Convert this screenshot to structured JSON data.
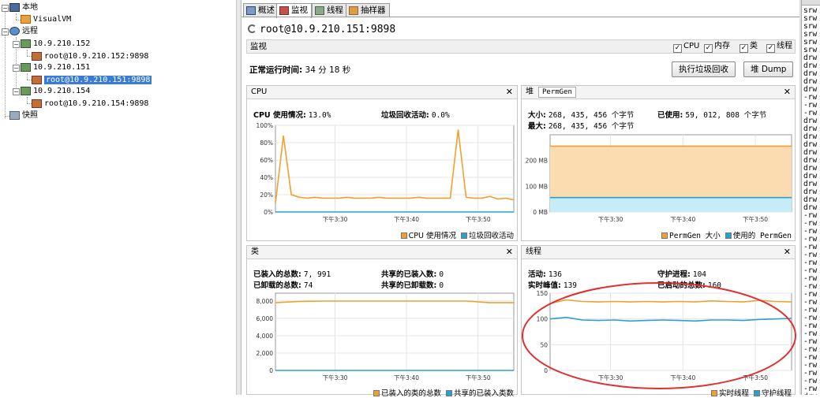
{
  "tree": {
    "local": "本地",
    "visualvm": "VisualVM",
    "remote": "远程",
    "hosts": [
      {
        "name": "10.9.210.152",
        "app": "root@10.9.210.152:9898"
      },
      {
        "name": "10.9.210.151",
        "app": "root@10.9.210.151:9898"
      },
      {
        "name": "10.9.210.154",
        "app": "root@10.9.210.154:9898"
      }
    ],
    "snapshots": "快照"
  },
  "tabs": [
    "概述",
    "监视",
    "线程",
    "抽样器"
  ],
  "active_tab": "监视",
  "title": "root@10.9.210.151:9898",
  "monitor": {
    "label": "监视",
    "checkboxes": [
      "CPU",
      "内存",
      "类",
      "线程"
    ],
    "uptime_label": "正常运行时间:",
    "uptime_value": "34 分 18 秒",
    "gc_button": "执行垃圾回收",
    "heapdump_button": "堆 Dump"
  },
  "cpu_panel": {
    "title": "CPU",
    "usage_label": "CPU 使用情况:",
    "usage_value": "13.0%",
    "gc_label": "垃圾回收活动:",
    "gc_value": "0.0%",
    "legend": [
      "CPU 使用情况",
      "垃圾回收活动"
    ]
  },
  "heap_panel": {
    "tab1": "堆",
    "tab2": "PermGen",
    "size_label": "大小:",
    "size_value": "268, 435, 456 个字节",
    "used_label": "已使用:",
    "used_value": "59, 012, 808 个字节",
    "max_label": "最大:",
    "max_value": "268, 435, 456 个字节",
    "legend": [
      "PermGen 大小",
      "使用的 PermGen"
    ]
  },
  "class_panel": {
    "title": "类",
    "loaded_label": "已装入的总数:",
    "loaded_value": "7, 991",
    "unloaded_label": "已卸载的总数:",
    "unloaded_value": "74",
    "shared_loaded_label": "共享的已装入数:",
    "shared_loaded_value": "0",
    "shared_unloaded_label": "共享的已卸载数:",
    "shared_unloaded_value": "0",
    "legend": [
      "已装入的类的总数",
      "共享的已装入类数"
    ]
  },
  "thread_panel": {
    "title": "线程",
    "live_label": "活动:",
    "live_value": "136",
    "daemon_label": "守护进程:",
    "daemon_value": "104",
    "peak_label": "实时峰值:",
    "peak_value": "139",
    "started_label": "已启动的总数:",
    "started_value": "160",
    "legend": [
      "实时线程",
      "守护线程"
    ]
  },
  "time_ticks": [
    "下午3:30",
    "下午3:40",
    "下午3:50"
  ],
  "colors": {
    "orange": "#f0a030",
    "blue": "#2aa0d0",
    "annotation": "#e03030"
  },
  "chart_data": [
    {
      "type": "line",
      "name": "CPU",
      "ylim": [
        0,
        100
      ],
      "yticks": [
        "0%",
        "20%",
        "40%",
        "60%",
        "80%",
        "100%"
      ],
      "series": [
        {
          "name": "CPU 使用情况",
          "values": [
            10,
            88,
            20,
            17,
            16,
            17,
            16,
            16,
            16,
            17,
            16,
            16,
            16,
            17,
            16,
            16,
            16,
            16,
            17,
            16,
            16,
            16,
            16,
            95,
            17,
            16,
            16,
            18,
            15,
            16,
            14
          ]
        },
        {
          "name": "垃圾回收活动",
          "values": [
            0,
            0,
            0,
            0,
            0,
            0,
            0,
            0,
            0,
            0,
            0,
            0,
            0,
            0,
            0,
            0,
            0,
            0,
            0,
            0,
            0,
            0,
            0,
            0,
            0,
            0,
            0,
            0,
            0,
            0,
            0
          ]
        }
      ]
    },
    {
      "type": "area",
      "name": "PermGen",
      "ylim": [
        0,
        300
      ],
      "yticks": [
        "0 MB",
        "100 MB",
        "200 MB"
      ],
      "series": [
        {
          "name": "PermGen 大小",
          "values": [
            256,
            256,
            256,
            256,
            256,
            256,
            256,
            256,
            256,
            256,
            256
          ]
        },
        {
          "name": "使用的 PermGen",
          "values": [
            56,
            56,
            56,
            56,
            56,
            56,
            56,
            56,
            56,
            56,
            56
          ]
        }
      ]
    },
    {
      "type": "line",
      "name": "类",
      "ylim": [
        0,
        8900
      ],
      "yticks": [
        "0",
        "2,000",
        "4,000",
        "6,000",
        "8,000"
      ],
      "series": [
        {
          "name": "已装入的类的总数",
          "values": [
            7800,
            7950,
            7990,
            7991,
            7991,
            7991,
            7991,
            7991,
            7991,
            7800,
            7800
          ]
        },
        {
          "name": "共享的已装入类数",
          "values": [
            0,
            0,
            0,
            0,
            0,
            0,
            0,
            0,
            0,
            0,
            0
          ]
        }
      ]
    },
    {
      "type": "line",
      "name": "线程",
      "ylim": [
        0,
        150
      ],
      "yticks": [
        "0",
        "50",
        "100",
        "150"
      ],
      "series": [
        {
          "name": "实时线程",
          "values": [
            130,
            137,
            134,
            133,
            134,
            133,
            134,
            133,
            134,
            133,
            135,
            134,
            133,
            136,
            134,
            133
          ]
        },
        {
          "name": "守护线程",
          "values": [
            100,
            103,
            98,
            97,
            98,
            96,
            97,
            98,
            97,
            96,
            98,
            98,
            97,
            99,
            100,
            101
          ]
        }
      ]
    }
  ],
  "terminal": {
    "lines": [
      "srw",
      "srw",
      "srw",
      "srw",
      "srw",
      "srw",
      "drw",
      "drw",
      "drw",
      "drw",
      "drw",
      "-rw",
      "-rw",
      "-rw",
      "drw",
      "drw",
      "drw",
      "drw",
      "drw",
      "drw",
      "drw",
      "drw",
      "drw",
      "drw",
      "drw",
      "drw",
      "-rw",
      "-rw",
      "-rw",
      "-rw",
      "-rw",
      "-rw",
      "-rw",
      "-rw",
      "-rw",
      "-rw",
      "-rw",
      "-rw",
      "-rw",
      "-rw",
      "-rw",
      "-rw",
      "-rw",
      "-rw",
      "-rw",
      "-rw",
      "-rw",
      "-rw",
      "-rw",
      "drw"
    ]
  }
}
